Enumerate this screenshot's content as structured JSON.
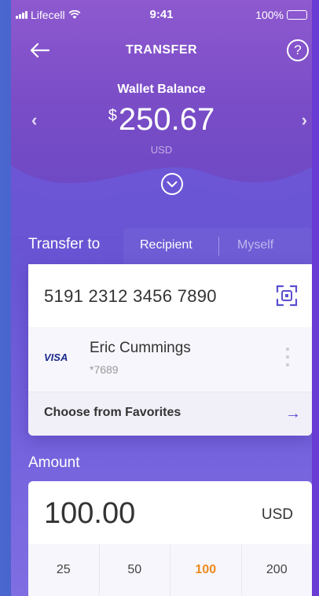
{
  "status": {
    "carrier": "Lifecell",
    "time": "9:41",
    "battery": "100%"
  },
  "nav": {
    "title": "TRANSFER",
    "help": "?"
  },
  "wallet": {
    "label": "Wallet Balance",
    "currency_symbol": "$",
    "amount": "250.67",
    "currency": "USD"
  },
  "transfer": {
    "label": "Transfer to",
    "tabs": [
      {
        "label": "Recipient"
      },
      {
        "label": "Myself"
      }
    ],
    "active_tab": "Recipient"
  },
  "card": {
    "number": "5191 2312 3456 7890"
  },
  "recipient": {
    "brand": "VISA",
    "name": "Eric Cummings",
    "last4": "*7689"
  },
  "favorites": {
    "label": "Choose from Favorites"
  },
  "amount": {
    "label": "Amount",
    "value": "100.00",
    "currency": "USD"
  },
  "quick_amounts": [
    {
      "label": "25"
    },
    {
      "label": "50"
    },
    {
      "label": "100"
    },
    {
      "label": "200"
    }
  ],
  "selected_quick_amount": "100",
  "colors": {
    "accent": "#6a53d2",
    "highlight": "#f08a1c",
    "link": "#5a4fd0"
  }
}
